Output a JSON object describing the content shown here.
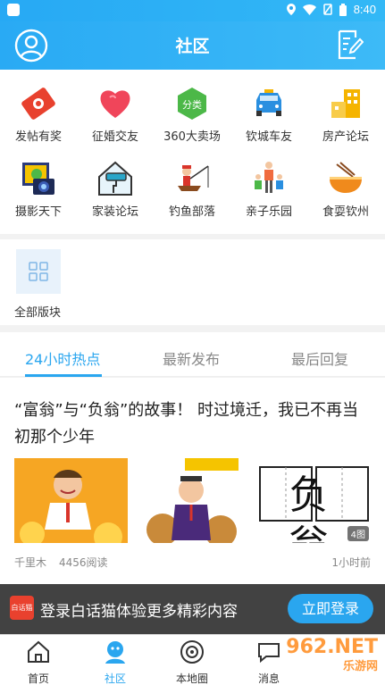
{
  "status_bar": {
    "time": "8:40"
  },
  "header": {
    "title": "社区",
    "avatar_icon": "user-avatar-icon",
    "edit_icon": "edit-note-icon"
  },
  "categories": [
    {
      "label": "发帖有奖",
      "icon": "red-envelope-icon",
      "color": "#e8412e"
    },
    {
      "label": "征婚交友",
      "icon": "heart-icon",
      "color": "#f0455a"
    },
    {
      "label": "360大卖场",
      "icon": "market-icon",
      "color": "#4cb848"
    },
    {
      "label": "钦城车友",
      "icon": "car-icon",
      "color": "#2a8fe0"
    },
    {
      "label": "房产论坛",
      "icon": "building-icon",
      "color": "#f5b400"
    },
    {
      "label": "摄影天下",
      "icon": "camera-icon",
      "color": "#3b5db5"
    },
    {
      "label": "家装论坛",
      "icon": "paint-roller-icon",
      "color": "#2aa6c9"
    },
    {
      "label": "钓鱼部落",
      "icon": "fishing-icon",
      "color": "#d9352b"
    },
    {
      "label": "亲子乐园",
      "icon": "family-icon",
      "color": "#f06b3f"
    },
    {
      "label": "食耍钦州",
      "icon": "noodle-bowl-icon",
      "color": "#f08a1c"
    }
  ],
  "all_sections": {
    "label": "全部版块",
    "icon": "grid-icon"
  },
  "tabs": [
    {
      "label": "24小时热点",
      "active": true
    },
    {
      "label": "最新发布",
      "active": false
    },
    {
      "label": "最后回复",
      "active": false
    }
  ],
  "post": {
    "title": "“富翁”与“负翁”的故事！ 时过境迁，我已不再当初那个少年",
    "image_count": "4图",
    "author": "千里木",
    "reads": "4456阅读",
    "time": "1小时前",
    "thumb3_text": "负 翁"
  },
  "login_banner": {
    "logo_text": "白话猫",
    "text": "登录白话猫体验更多精彩内容",
    "button": "立即登录"
  },
  "bottom_nav": [
    {
      "label": "首页",
      "icon": "home-icon",
      "active": false
    },
    {
      "label": "社区",
      "icon": "community-icon",
      "active": true
    },
    {
      "label": "本地圈",
      "icon": "local-circle-icon",
      "active": false
    },
    {
      "label": "消息",
      "icon": "message-icon",
      "active": false
    }
  ],
  "watermark": {
    "main": "962.NET",
    "sub": "乐游网"
  }
}
